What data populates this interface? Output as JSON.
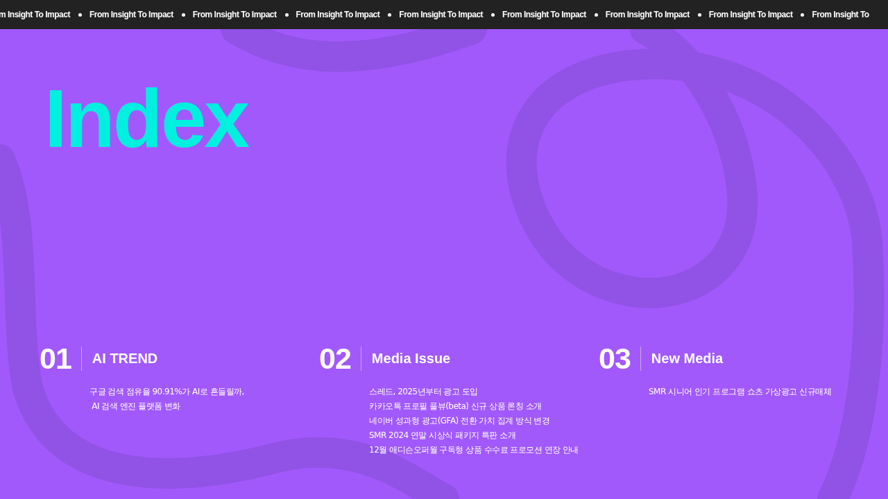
{
  "ticker": [
    "m Insight To Impact",
    "From Insight To Impact",
    "From Insight To Impact",
    "From Insight To Impact",
    "From Insight To Impact",
    "From Insight To Impact",
    "From Insight To Impact",
    "From Insight To Impact",
    "From Insight To"
  ],
  "title": "Index",
  "sections": [
    {
      "number": "01",
      "heading": "AI TREND",
      "items": [
        "구글 검색 점유율 90.91%가 AI로 흔들릴까,\n AI 검색 엔진 플랫폼 변화"
      ]
    },
    {
      "number": "02",
      "heading": "Media Issue",
      "items": [
        "스레드, 2025년부터 광고 도입",
        "카카오톡 프로필 풀뷰(beta) 신규 상품 론칭 소개",
        "네이버 성과형 광고(GFA) 전환 가치 집계 방식 변경",
        "SMR 2024 연말 시상식 패키지 특판 소개",
        "12월 애디슨오퍼월 구독형 상품 수수료 프로모션 연장 안내"
      ]
    },
    {
      "number": "03",
      "heading": "New Media",
      "items": [
        "SMR 시니어 인기 프로그램 쇼츠 가상광고 신규매체"
      ]
    }
  ]
}
